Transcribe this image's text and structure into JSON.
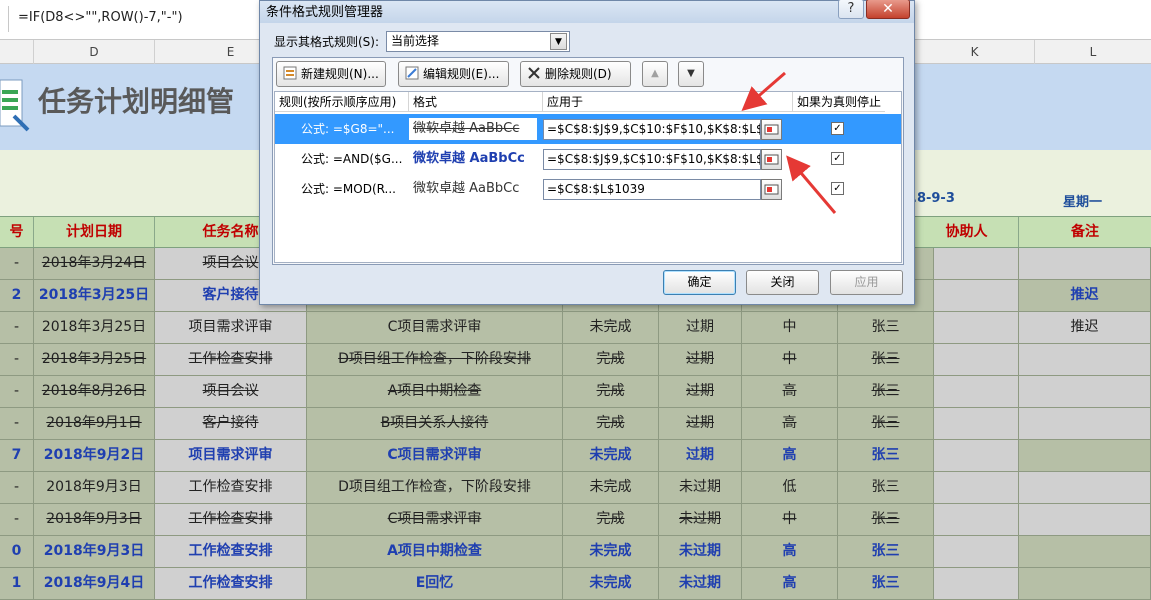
{
  "formula_bar": {
    "formula": "=IF(D8<>\"\",ROW()-7,\"-\")"
  },
  "columns": [
    "D",
    "E",
    "K",
    "L"
  ],
  "sheet": {
    "title": "任务计划明细管",
    "date_text": ".8-9-3",
    "weekday_text": "星期一",
    "headers": [
      "号",
      "计划日期",
      "任务名称",
      "协助人",
      "备注"
    ],
    "rows": [
      {
        "no": "-",
        "date": "2018年3月24日",
        "task": "项目会议",
        "detail": "",
        "status": "",
        "due": "",
        "priority": "",
        "owner": "",
        "helper": "",
        "note": "",
        "style": "strike"
      },
      {
        "no": "2",
        "date": "2018年3月25日",
        "task": "客户接待",
        "detail": "",
        "status": "",
        "due": "",
        "priority": "",
        "owner": "",
        "helper": "",
        "note": "推迟",
        "style": "blue"
      },
      {
        "no": "-",
        "date": "2018年3月25日",
        "task": "项目需求评审",
        "detail": "C项目需求评审",
        "status": "未完成",
        "due": "过期",
        "priority": "中",
        "owner": "张三",
        "helper": "",
        "note": "推迟",
        "style": "normal"
      },
      {
        "no": "-",
        "date": "2018年3月25日",
        "task": "工作检查安排",
        "detail": "D项目组工作检查，下阶段安排",
        "status": "完成",
        "due": "过期",
        "priority": "中",
        "owner": "张三",
        "helper": "",
        "note": "",
        "style": "strike"
      },
      {
        "no": "-",
        "date": "2018年8月26日",
        "task": "项目会议",
        "detail": "A项目中期检查",
        "status": "完成",
        "due": "过期",
        "priority": "高",
        "owner": "张三",
        "helper": "",
        "note": "",
        "style": "strike"
      },
      {
        "no": "-",
        "date": "2018年9月1日",
        "task": "客户接待",
        "detail": "B项目关系人接待",
        "status": "完成",
        "due": "过期",
        "priority": "高",
        "owner": "张三",
        "helper": "",
        "note": "",
        "style": "strike"
      },
      {
        "no": "7",
        "date": "2018年9月2日",
        "task": "项目需求评审",
        "detail": "C项目需求评审",
        "status": "未完成",
        "due": "过期",
        "priority": "高",
        "owner": "张三",
        "helper": "",
        "note": "",
        "style": "blue"
      },
      {
        "no": "-",
        "date": "2018年9月3日",
        "task": "工作检查安排",
        "detail": "D项目组工作检查，下阶段安排",
        "status": "未完成",
        "due": "未过期",
        "priority": "低",
        "owner": "张三",
        "helper": "",
        "note": "",
        "style": "normal"
      },
      {
        "no": "-",
        "date": "2018年9月3日",
        "task": "工作检查安排",
        "detail": "C项目需求评审",
        "status": "完成",
        "due": "未过期",
        "priority": "中",
        "owner": "张三",
        "helper": "",
        "note": "",
        "style": "strike"
      },
      {
        "no": "0",
        "date": "2018年9月3日",
        "task": "工作检查安排",
        "detail": "A项目中期检查",
        "status": "未完成",
        "due": "未过期",
        "priority": "高",
        "owner": "张三",
        "helper": "",
        "note": "",
        "style": "blue"
      },
      {
        "no": "1",
        "date": "2018年9月4日",
        "task": "工作检查安排",
        "detail": "E回忆",
        "status": "未完成",
        "due": "未过期",
        "priority": "高",
        "owner": "张三",
        "helper": "",
        "note": "",
        "style": "blue"
      }
    ]
  },
  "dialog": {
    "title": "条件格式规则管理器",
    "help": "?",
    "close": "✕",
    "show_label": "显示其格式规则(S):",
    "show_value": "当前选择",
    "buttons": {
      "new_rule": "新建规则(N)...",
      "edit_rule": "编辑规则(E)...",
      "delete_rule": "删除规则(D)",
      "up": "▲",
      "down": "▼"
    },
    "list_headers": [
      "规则(按所示顺序应用)",
      "格式",
      "应用于",
      "如果为真则停止"
    ],
    "rules": [
      {
        "name": "公式: =$G8=\"...",
        "preview": "微软卓越  AaBbCc",
        "applies_to": "=$C$8:$J$9,$C$10:$F$10,$K$8:$L$10",
        "stop": "✓"
      },
      {
        "name": "公式: =AND($G...",
        "preview": "微软卓越  AaBbCc",
        "applies_to": "=$C$8:$J$9,$C$10:$F$10,$K$8:$L$10",
        "stop": "✓"
      },
      {
        "name": "公式: =MOD(R...",
        "preview": "微软卓越  AaBbCc",
        "applies_to": "=$C$8:$L$1039",
        "stop": "✓"
      }
    ],
    "ok": "确定",
    "close_btn": "关闭",
    "apply": "应用"
  },
  "colors": {
    "header_bg": "#c6e0b4",
    "header_text": "#c00000",
    "row_bg": "#b6bfa6",
    "blue_text": "#1f3fb0",
    "title_band": "#c5d9f1",
    "arrow_red": "#e53935"
  }
}
